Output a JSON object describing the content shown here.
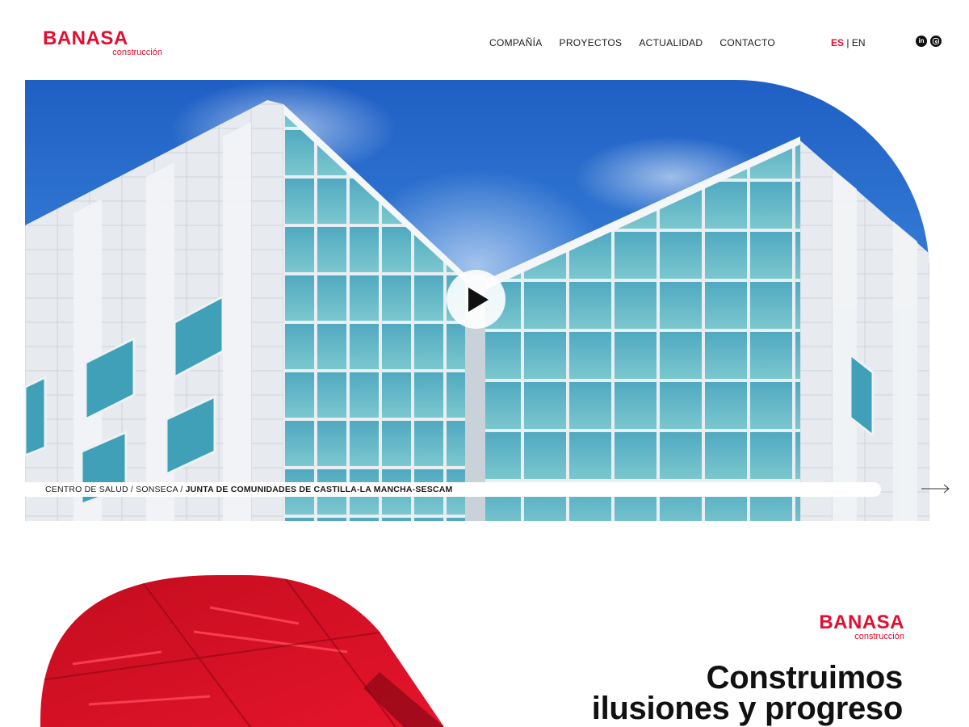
{
  "header": {
    "logo": {
      "brand": "BANASA",
      "sub": "construcción"
    },
    "nav": [
      "COMPAÑÍA",
      "PROYECTOS",
      "ACTUALIDAD",
      "CONTACTO"
    ],
    "lang": {
      "active": "ES",
      "separator": "|",
      "other": "EN"
    },
    "social": {
      "linkedin": "in"
    }
  },
  "hero": {
    "caption_plain": "CENTRO DE SALUD / SONSECA / ",
    "caption_bold": "JUNTA DE COMUNIDADES DE CASTILLA-LA MANCHA-SESCAM"
  },
  "intro": {
    "logo": {
      "brand": "BANASA",
      "sub": "construcción"
    },
    "headline_line1": "Construimos",
    "headline_line2": "ilusiones y progreso"
  },
  "colors": {
    "brand_red": "#e30d2e",
    "text": "#1a1a1a",
    "sky": "#2a6fd0"
  },
  "icons": [
    "linkedin-icon",
    "instagram-icon",
    "play-icon",
    "arrow-right-icon"
  ]
}
